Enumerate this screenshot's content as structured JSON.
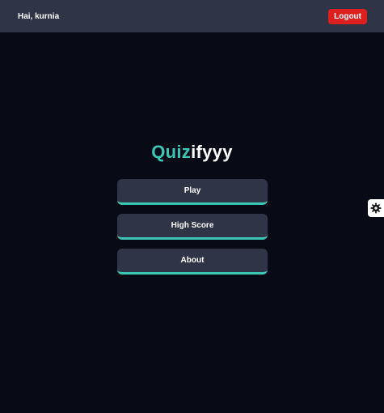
{
  "header": {
    "greeting": "Hai, kurnia",
    "logout_label": "Logout"
  },
  "title": {
    "accent": "Quiz",
    "rest": "ifyyy"
  },
  "menu": {
    "items": [
      {
        "label": "Play"
      },
      {
        "label": "High Score"
      },
      {
        "label": "About"
      }
    ]
  },
  "theme_toggle": {
    "icon": "gear-icon"
  },
  "colors": {
    "background": "#080b15",
    "panel": "#2f3447",
    "accent": "#3cc6b4",
    "danger": "#dc1f1f"
  }
}
